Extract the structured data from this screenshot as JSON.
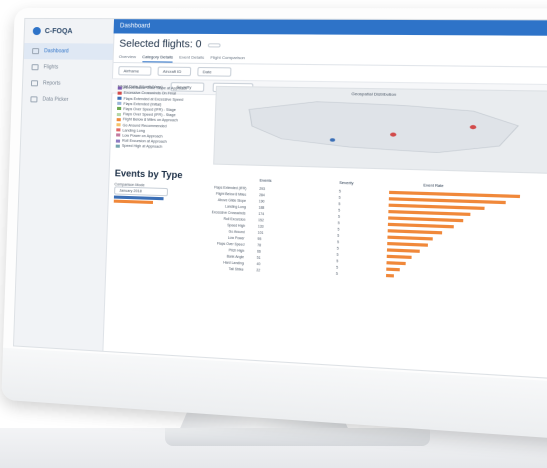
{
  "app": {
    "logo_text": "C-FOQA"
  },
  "sidebar": {
    "items": [
      {
        "label": "Dashboard",
        "active": true
      },
      {
        "label": "Flights"
      },
      {
        "label": "Reports"
      },
      {
        "label": "Data Picker"
      }
    ]
  },
  "topbar": {
    "title": "Dashboard"
  },
  "page": {
    "title": "Selected flights: 0",
    "title_button": ""
  },
  "tabs": [
    "Overview",
    "Category Details",
    "Event Details",
    "Flight Comparison"
  ],
  "filters": {
    "aircraft_label": "Airframe",
    "fleet_label": "Aircraft ID",
    "date_label": "Date"
  },
  "filters2": {
    "flight_label": "Flight Data (Month/Year)",
    "severity_label": "Severity",
    "event_label": "Event Category"
  },
  "map": {
    "title": "Geospatial Distribution"
  },
  "legend_items": [
    {
      "label": "Above/Below Glide Slope at Approach",
      "color": "#7c5cb0"
    },
    {
      "label": "Excessive Crosswinds On Final",
      "color": "#d24b4b"
    },
    {
      "label": "Flaps Extended at Excessive Speed",
      "color": "#3b6fb6"
    },
    {
      "label": "Flaps Extended (Initial)",
      "color": "#9ab6d9"
    },
    {
      "label": "Flaps Over Speed (IFR) - Stage",
      "color": "#6aa84f"
    },
    {
      "label": "Flaps Over Speed (IFR) - Stage",
      "color": "#b6d7a8"
    },
    {
      "label": "Flight Below 8 Miles on Approach",
      "color": "#f0883a"
    },
    {
      "label": "Go Around Recommended",
      "color": "#f6c26b"
    },
    {
      "label": "Landing Long",
      "color": "#e06666"
    },
    {
      "label": "Low Power on Approach",
      "color": "#c27ba0"
    },
    {
      "label": "Roll Excursion at Approach",
      "color": "#8e7cc3"
    },
    {
      "label": "Speed High at Approach",
      "color": "#76a5af"
    }
  ],
  "events": {
    "title": "Events by Type",
    "left_title": "Comparison Mode",
    "left_option": "January 2018",
    "col_headers": [
      "Events",
      "Severity",
      "Event Rate"
    ],
    "rows": [
      {
        "name": "Flaps Extended (IFR)",
        "val": "293",
        "sev": "5",
        "bar": 0.95
      },
      {
        "name": "Flight Below 8 Miles",
        "val": "284",
        "sev": "5",
        "bar": 0.85
      },
      {
        "name": "Above Glide Slope",
        "val": "190",
        "sev": "5",
        "bar": 0.7
      },
      {
        "name": "Landing Long",
        "val": "188",
        "sev": "5",
        "bar": 0.6
      },
      {
        "name": "Excessive Crosswinds",
        "val": "174",
        "sev": "5",
        "bar": 0.55
      },
      {
        "name": "Roll Excursion",
        "val": "152",
        "sev": "5",
        "bar": 0.48
      },
      {
        "name": "Speed High",
        "val": "133",
        "sev": "5",
        "bar": 0.4
      },
      {
        "name": "Go Around",
        "val": "101",
        "sev": "5",
        "bar": 0.33
      },
      {
        "name": "Low Power",
        "val": "95",
        "sev": "5",
        "bar": 0.3
      },
      {
        "name": "Flaps Over Speed",
        "val": "78",
        "sev": "5",
        "bar": 0.24
      },
      {
        "name": "Pitch High",
        "val": "66",
        "sev": "5",
        "bar": 0.18
      },
      {
        "name": "Bank Angle",
        "val": "51",
        "sev": "5",
        "bar": 0.14
      },
      {
        "name": "Hard Landing",
        "val": "40",
        "sev": "5",
        "bar": 0.1
      },
      {
        "name": "Tail Strike",
        "val": "22",
        "sev": "5",
        "bar": 0.06
      }
    ]
  }
}
